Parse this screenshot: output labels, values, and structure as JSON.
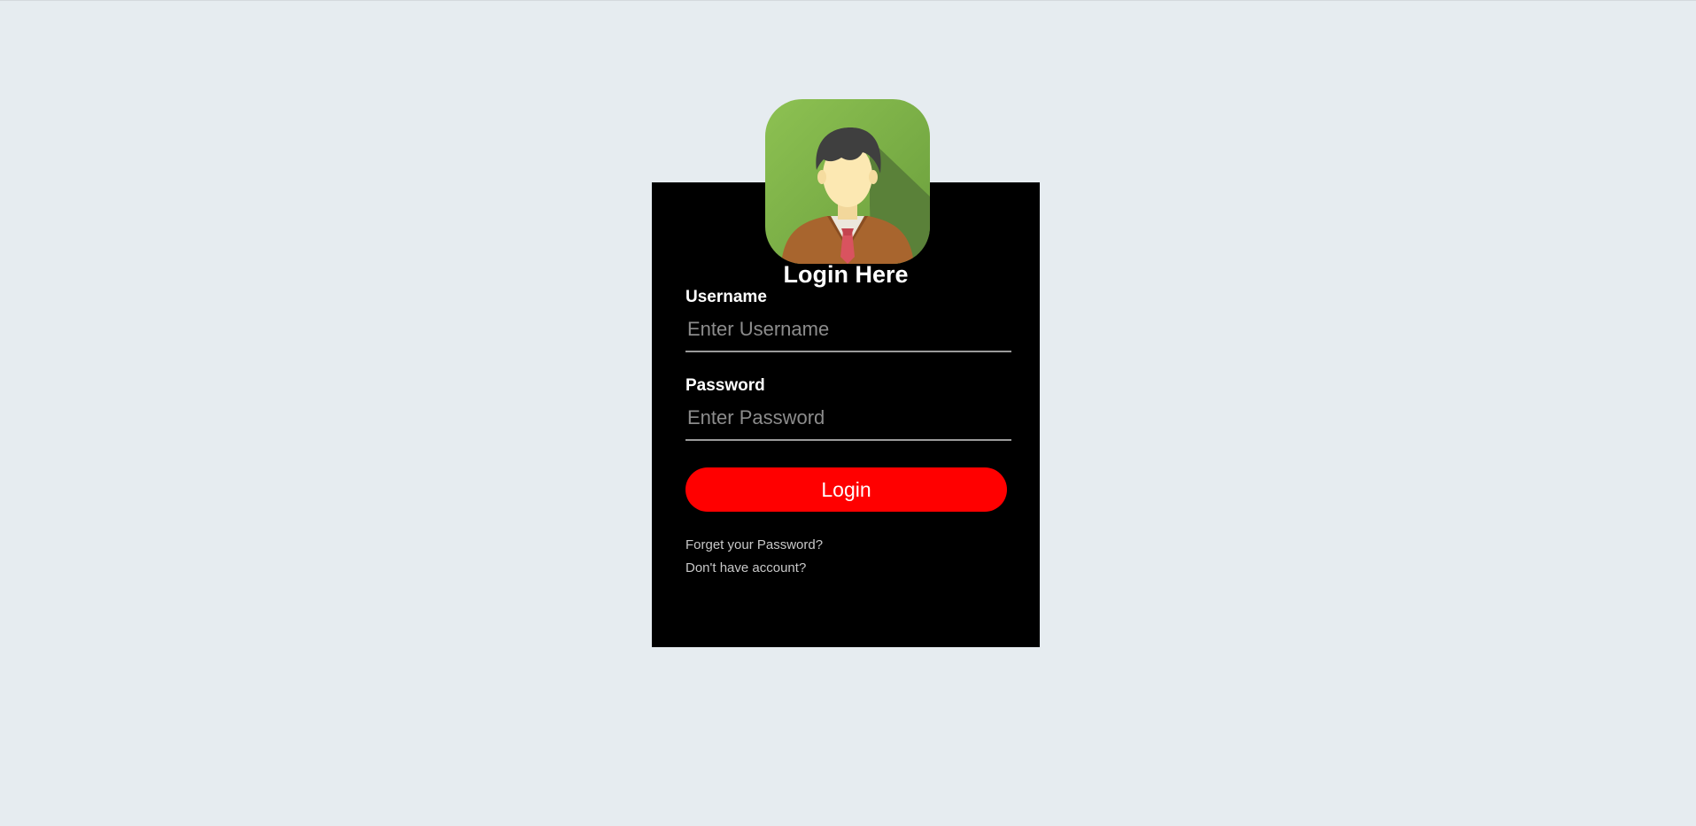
{
  "login": {
    "title": "Login Here",
    "avatar_icon": "user-avatar-icon",
    "username": {
      "label": "Username",
      "placeholder": "Enter Username",
      "value": ""
    },
    "password": {
      "label": "Password",
      "placeholder": "Enter Password",
      "value": ""
    },
    "submit_label": "Login",
    "forgot_link": "Forget your Password?",
    "signup_link": "Don't have account?"
  },
  "colors": {
    "page_background": "#e6ecf0",
    "box_background": "#000000",
    "button": "#ff0000",
    "avatar_green": "#8bc34a",
    "input_underline": "#9a9a9a",
    "link_text": "#c8c8c8"
  }
}
